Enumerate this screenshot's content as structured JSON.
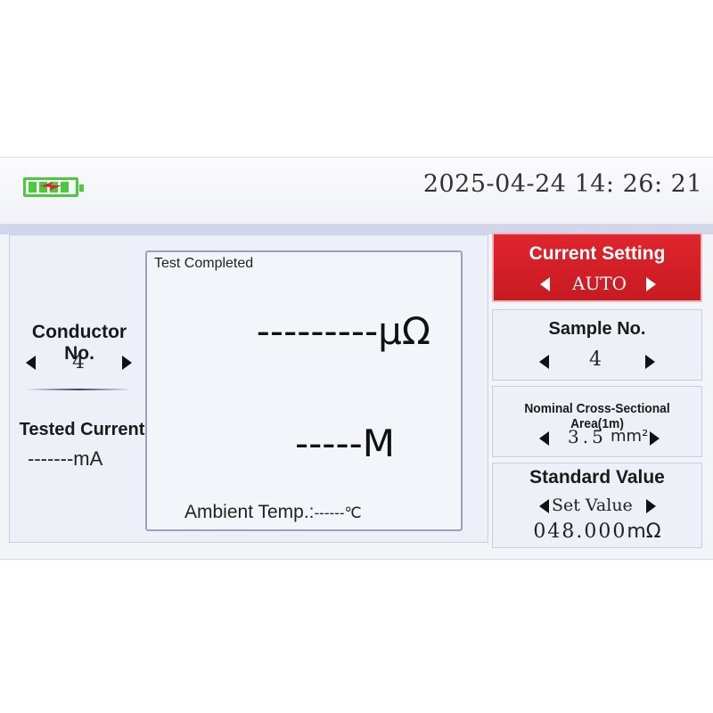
{
  "header": {
    "battery_icon": "battery-charging-icon",
    "datetime": "2025-04-24 14: 26: 21"
  },
  "left": {
    "conductor_label": "Conductor No.",
    "conductor_value": "4",
    "tested_current_label": "Tested Current",
    "tested_current_value": "-------mA"
  },
  "center": {
    "status": "Test Completed",
    "resistance": "---------μΩ",
    "length": "-----M",
    "ambient_label": "Ambient Temp.:",
    "ambient_value": "------℃"
  },
  "right": {
    "current_setting_label": "Current Setting",
    "current_setting_value": "AUTO",
    "sample_label": "Sample No.",
    "sample_value": "4",
    "area_label": "Nominal Cross-Sectional Area(1m)",
    "area_value": "3.5",
    "area_unit": "mm²",
    "standard_label": "Standard Value",
    "standard_sub": "Set Value",
    "standard_value": "048.000",
    "standard_unit": "mΩ"
  },
  "colors": {
    "accent_red": "#d8202a",
    "battery_green": "#4cc93e",
    "panel_bg": "#eef0f8"
  }
}
